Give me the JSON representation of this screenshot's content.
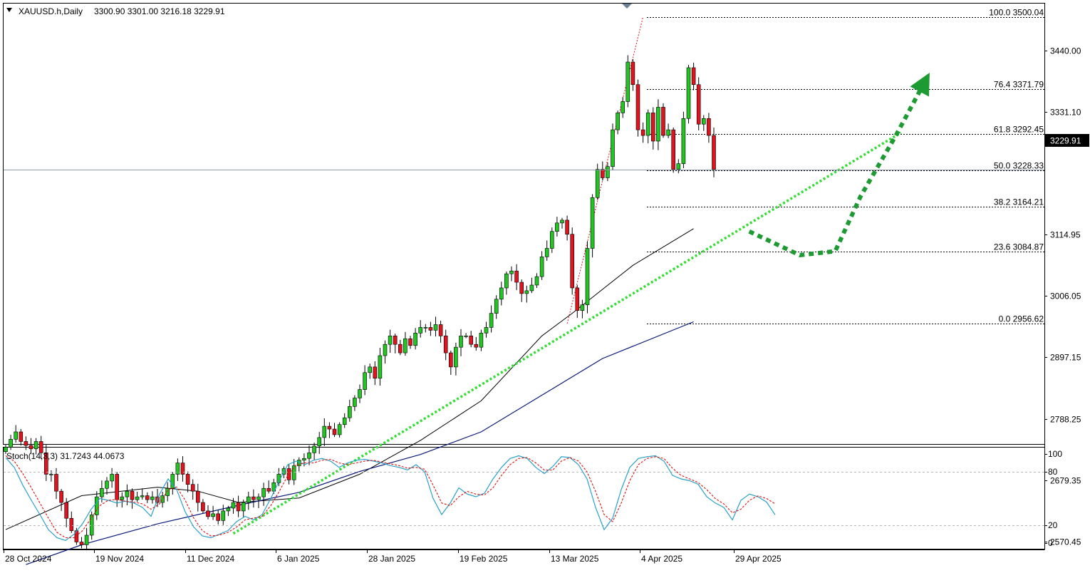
{
  "header": {
    "symbol_timeframe": "XAUUSD.h,Daily",
    "ohlc": "3300.90 3301.00 3216.18 3229.91"
  },
  "current_price": {
    "label": "3229.91",
    "value": 3229.91
  },
  "colors": {
    "bull_candle": "#22c522",
    "bear_candle": "#e0141e",
    "ma_fast": "#000000",
    "ma_slow": "#0a1a7a",
    "trendline": "#33dd33",
    "projection_arrow": "#1e9a32",
    "stoch_main": "#2aa0c8",
    "stoch_signal": "#dd1111"
  },
  "chart_data": {
    "type": "candlestick",
    "title": "XAUUSD.h,Daily",
    "y_axis_ticks": [
      "3440.00",
      "3331.10",
      "3114.95",
      "3006.05",
      "2897.15",
      "2788.25",
      "2679.35",
      "2570.45"
    ],
    "x_axis_labels": [
      "28 Oct 2024",
      "19 Nov 2024",
      "11 Dec 2024",
      "6 Jan 2025",
      "28 Jan 2025",
      "19 Feb 2025",
      "13 Mar 2025",
      "4 Apr 2025",
      "29 Apr 2025"
    ],
    "ylim": [
      2520,
      3530
    ],
    "fibonacci": [
      {
        "label": "100.0 3500.04",
        "price": 3500.04
      },
      {
        "label": "76.4 3371.79",
        "price": 3371.79
      },
      {
        "label": "61.8 3292.45",
        "price": 3292.45
      },
      {
        "label": "50.0 3228.33",
        "price": 3228.33
      },
      {
        "label": "38.2 3164.21",
        "price": 3164.21
      },
      {
        "label": "23.6 3084.87",
        "price": 3084.87
      },
      {
        "label": "0.0 2956.62",
        "price": 2956.62
      }
    ],
    "candles_close": [
      2738,
      2752,
      2765,
      2748,
      2741,
      2735,
      2748,
      2728,
      2690,
      2690,
      2660,
      2640,
      2612,
      2590,
      2570,
      2565,
      2582,
      2618,
      2650,
      2665,
      2678,
      2690,
      2645,
      2650,
      2660,
      2645,
      2650,
      2652,
      2645,
      2650,
      2640,
      2652,
      2665,
      2690,
      2710,
      2690,
      2672,
      2660,
      2640,
      2625,
      2615,
      2620,
      2608,
      2625,
      2630,
      2640,
      2625,
      2640,
      2650,
      2645,
      2650,
      2665,
      2660,
      2675,
      2690,
      2700,
      2680,
      2705,
      2715,
      2718,
      2728,
      2740,
      2755,
      2775,
      2770,
      2760,
      2778,
      2790,
      2810,
      2825,
      2840,
      2870,
      2880,
      2860,
      2900,
      2920,
      2935,
      2920,
      2905,
      2930,
      2918,
      2940,
      2950,
      2950,
      2945,
      2955,
      2935,
      2905,
      2880,
      2915,
      2935,
      2935,
      2920,
      2915,
      2940,
      2950,
      2975,
      3000,
      3020,
      3045,
      3050,
      3030,
      3010,
      3015,
      3025,
      3040,
      3075,
      3090,
      3120,
      3135,
      3140,
      3115,
      3020,
      2980,
      2990,
      3090,
      3180,
      3230,
      3215,
      3235,
      3300,
      3330,
      3350,
      3420,
      3380,
      3300,
      3290,
      3330,
      3280,
      3340,
      3290,
      3300,
      3230,
      3240,
      3320,
      3410,
      3380,
      3310,
      3320,
      3290,
      3229.91
    ],
    "ma_fast_points": [
      [
        0,
        2592
      ],
      [
        15,
        2652
      ],
      [
        30,
        2667
      ],
      [
        38,
        2660
      ],
      [
        46,
        2640
      ],
      [
        58,
        2648
      ],
      [
        70,
        2690
      ],
      [
        82,
        2750
      ],
      [
        94,
        2820
      ],
      [
        106,
        2935
      ],
      [
        112,
        2975
      ],
      [
        124,
        3060
      ],
      [
        136,
        3125
      ]
    ],
    "ma_slow_points": [
      [
        4,
        2530
      ],
      [
        15,
        2565
      ],
      [
        30,
        2602
      ],
      [
        46,
        2635
      ],
      [
        58,
        2658
      ],
      [
        70,
        2695
      ],
      [
        82,
        2725
      ],
      [
        94,
        2765
      ],
      [
        106,
        2830
      ],
      [
        118,
        2895
      ],
      [
        136,
        2960
      ]
    ],
    "trendline": {
      "from": [
        45,
        2585
      ],
      "to": [
        177,
        3295
      ]
    },
    "projection_arrow": [
      [
        147,
        3120
      ],
      [
        157,
        3078
      ],
      [
        164,
        3085
      ],
      [
        169,
        3182
      ],
      [
        176,
        3290
      ],
      [
        182,
        3390
      ]
    ],
    "stochastic": {
      "label": "Stoch(14,3,3) 31.7243 44.0673",
      "main": 31.7243,
      "signal": 44.0673,
      "levels": [
        "100",
        "80",
        "20",
        "0"
      ],
      "main_series": [
        96,
        85,
        65,
        48,
        32,
        15,
        6,
        3,
        10,
        22,
        38,
        50,
        48,
        45,
        47,
        45,
        40,
        30,
        55,
        72,
        60,
        35,
        18,
        8,
        6,
        10,
        14,
        24,
        30,
        26,
        32,
        50,
        70,
        88,
        92,
        88,
        93,
        95,
        92,
        85,
        90,
        93,
        94,
        92,
        90,
        87,
        85,
        82,
        88,
        80,
        50,
        32,
        45,
        62,
        55,
        52,
        56,
        72,
        85,
        95,
        98,
        95,
        85,
        78,
        86,
        97,
        96,
        88,
        72,
        40,
        15,
        28,
        60,
        85,
        95,
        97,
        98,
        92,
        76,
        72,
        70,
        66,
        52,
        45,
        40,
        26,
        48,
        55,
        52,
        46,
        31.7243
      ],
      "signal_series": [
        98,
        92,
        78,
        62,
        45,
        28,
        12,
        6,
        6,
        14,
        28,
        42,
        48,
        49,
        47,
        46,
        44,
        38,
        44,
        60,
        63,
        48,
        28,
        14,
        8,
        9,
        12,
        18,
        26,
        28,
        30,
        42,
        58,
        76,
        88,
        90,
        90,
        93,
        94,
        90,
        88,
        90,
        92,
        93,
        91,
        89,
        87,
        84,
        85,
        83,
        65,
        45,
        42,
        52,
        58,
        55,
        54,
        62,
        76,
        88,
        95,
        96,
        90,
        82,
        82,
        92,
        96,
        92,
        80,
        58,
        32,
        24,
        45,
        70,
        88,
        95,
        97,
        95,
        84,
        76,
        72,
        68,
        60,
        50,
        44,
        34,
        38,
        48,
        53,
        50,
        44.0673
      ]
    }
  }
}
